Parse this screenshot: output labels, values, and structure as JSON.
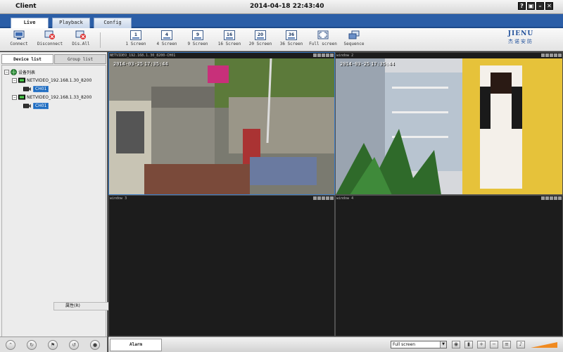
{
  "window": {
    "title": "Client",
    "datetime": "2014-04-18 22:43:40",
    "controls": [
      "?",
      "▣",
      "–",
      "✕"
    ]
  },
  "tabs": [
    {
      "label": "Live",
      "active": true
    },
    {
      "label": "Playback",
      "active": false
    },
    {
      "label": "Config",
      "active": false
    }
  ],
  "toolbar": {
    "connect": "Connect",
    "disconnect": "Disconnect",
    "dis_all": "Dis.All",
    "screens": [
      {
        "num": "1",
        "label": "1 Screen"
      },
      {
        "num": "4",
        "label": "4 Screen"
      },
      {
        "num": "9",
        "label": "9 Screen"
      },
      {
        "num": "16",
        "label": "16 Screen"
      },
      {
        "num": "20",
        "label": "20 Screen"
      },
      {
        "num": "36",
        "label": "36 Screen"
      }
    ],
    "fullscreen": "Full screen",
    "sequence": "Sequence"
  },
  "logo": {
    "brand": "JIENU",
    "brand_cn": "杰诺安防"
  },
  "sidebar": {
    "tabs": [
      {
        "label": "Device list",
        "active": true
      },
      {
        "label": "Group list",
        "active": false
      }
    ],
    "tree": {
      "root": "设备列表",
      "devices": [
        {
          "name": "NETVIDEO_192.168.1.30_8200",
          "channel": "CH01"
        },
        {
          "name": "NETVIDEO_192.168.1.33_8200",
          "channel": "CH01"
        }
      ]
    },
    "context_menu": "属性(R)"
  },
  "windows": [
    {
      "title": "NETVIDEO_192.168.1.30_8200-CH01",
      "osd_date": "2014-03-25",
      "osd_time": "17:35:44"
    },
    {
      "title": "window 2",
      "osd_date": "2014-03-25",
      "osd_time": "17:35:44"
    },
    {
      "title": "window 3"
    },
    {
      "title": "window 4"
    }
  ],
  "bottombar": {
    "alarm_tab": "Alarm",
    "view_mode": "Full screen"
  },
  "colors": {
    "accent": "#2b5ea7",
    "selection": "#1e6cc0"
  }
}
